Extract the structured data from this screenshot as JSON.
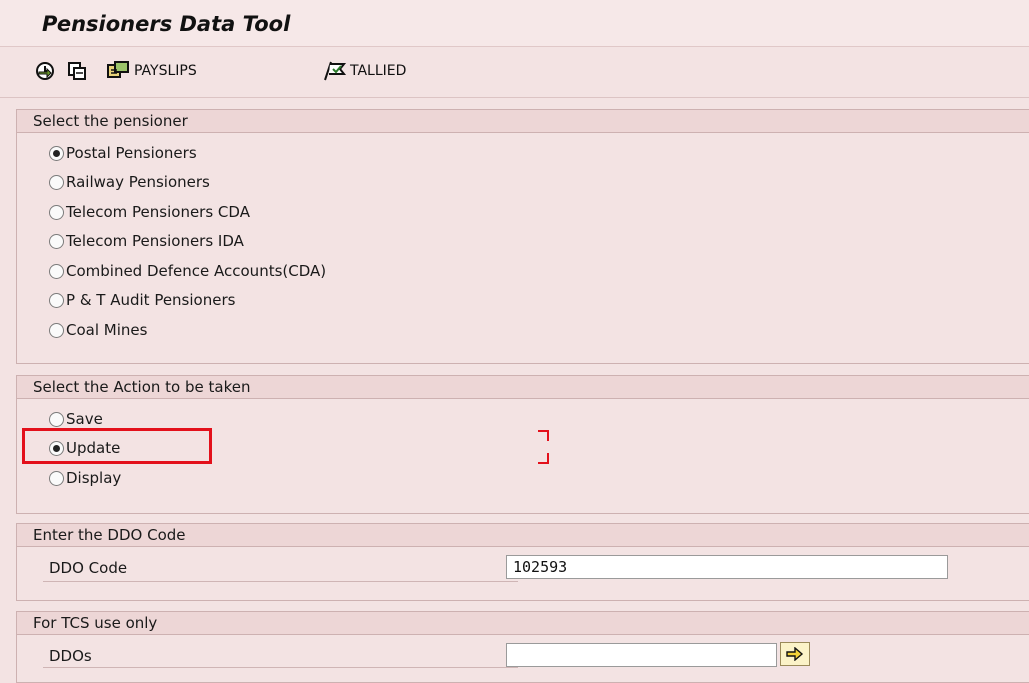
{
  "app": {
    "title": "Pensioners Data Tool"
  },
  "toolbar": {
    "payslips_label": "PAYSLIPS",
    "tallied_label": "TALLIED",
    "icons": [
      "execute-icon",
      "copy-icon",
      "payslips-icon",
      "tallied-icon"
    ]
  },
  "pensioner_group": {
    "title": "Select the pensioner",
    "options": [
      {
        "label": "Postal Pensioners",
        "selected": true
      },
      {
        "label": "Railway Pensioners",
        "selected": false
      },
      {
        "label": "Telecom Pensioners CDA",
        "selected": false
      },
      {
        "label": "Telecom Pensioners IDA",
        "selected": false
      },
      {
        "label": "Combined Defence Accounts(CDA)",
        "selected": false
      },
      {
        "label": "P & T Audit Pensioners",
        "selected": false
      },
      {
        "label": "Coal Mines",
        "selected": false
      }
    ]
  },
  "action_group": {
    "title": "Select the Action to be taken",
    "options": [
      {
        "label": "Save",
        "selected": false
      },
      {
        "label": "Update",
        "selected": true
      },
      {
        "label": "Display",
        "selected": false
      }
    ]
  },
  "ddo_group": {
    "title": "Enter the DDO Code",
    "field_label": "DDO Code",
    "value": "102593"
  },
  "tcs_group": {
    "title": "For TCS use only",
    "field_label": "DDOs",
    "value": ""
  },
  "colors": {
    "background": "#f3e3e3",
    "highlight": "#e3101b"
  }
}
